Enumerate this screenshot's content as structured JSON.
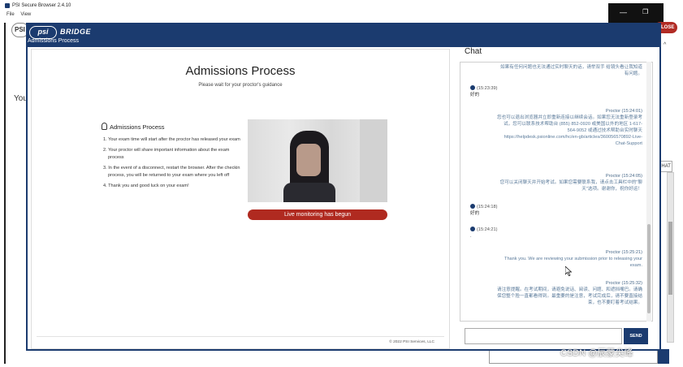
{
  "outer_window": {
    "title": "PSI Secure Browser 2.4.10",
    "menu": [
      "File",
      "View"
    ],
    "minimize_glyph": "—",
    "maximize_glyph": "❐"
  },
  "background": {
    "logo_text": "PSI",
    "partial_text": "You",
    "close_label": "CLOSE",
    "chat_tab": "CHAT",
    "caret": "^"
  },
  "app": {
    "logo": "psi",
    "bridge": "BRIDGE",
    "header_subtitle": "Admissions Process",
    "main_title": "Admissions Process",
    "main_subtitle": "Please wait for your proctor's guidance",
    "instructions_title": "Admissions Process",
    "instructions": [
      "1. Your exam time will start after the proctor has released your exam",
      "2. Your proctor will share important information about the exam process",
      "3. In the event of a disconnect, restart the browser. After the checkin process, you will be returned to your exam where you left off",
      "4. Thank you and good luck on your exam!"
    ],
    "live_banner": "Live monitoring has begun",
    "copyright": "© 2022 PSI Services, LLC"
  },
  "chat": {
    "heading": "Chat",
    "messages": [
      {
        "role": "proctor",
        "who": "",
        "text": "如果有任何问题也无法通过实时聊天的话，请举双手 给镜头看让我知道有问题。"
      },
      {
        "role": "user",
        "who": "(15:23:39)",
        "text": "好的"
      },
      {
        "role": "proctor",
        "who": "Proctor (15:24:01)",
        "text": "您也可以退出浏览器并立即重新连接以继续会话。如果您无法重新登录考试，您可以联系技术帮助台 (855) 852-0920 或美国以外的地区 1-617-564-9052 或通过技术帮助台实时聊天 https://helpdesk.psionline.com/hc/en-gb/articles/360056570892-Live-Chat-Support"
      },
      {
        "role": "proctor",
        "who": "Proctor (15:24:05)",
        "text": "您可以关闭聊天并开始考试。如果您需要联系我，请点击工具栏中的\"聊天\"选项。谢谢你，祝你好运！"
      },
      {
        "role": "user",
        "who": "(15:24:18)",
        "text": "好的"
      },
      {
        "role": "user",
        "who": "(15:24:21)",
        "text": "."
      },
      {
        "role": "proctor",
        "who": "Proctor (15:25:21)",
        "text": "Thank you. We are reviewing your submission prior to releasing your exam."
      },
      {
        "role": "proctor",
        "who": "Proctor (15:25:32)",
        "text": "请注意提醒。在考试期间，请避免说话、阅读、问题、和遮挡嘴巴。请确保您整个脸一直都看得到。最重要的是注意，考试完成后，请不要直接结束，也不要盯着考试结果。"
      }
    ],
    "input_value": "",
    "send_label": "SEND"
  },
  "watermark": "CSDN @辰蒙尖峰"
}
